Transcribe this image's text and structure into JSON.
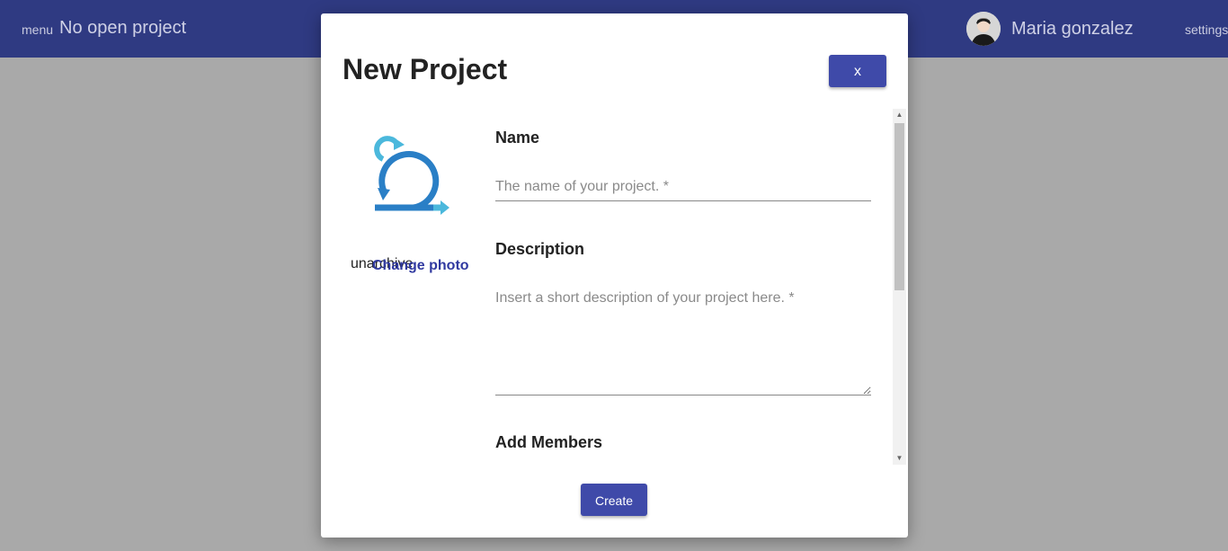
{
  "topbar": {
    "menu_label": "menu",
    "project_title": "No open project",
    "user_name": "Maria gonzalez",
    "settings_label": "settings"
  },
  "modal": {
    "title": "New Project",
    "close_label": "x",
    "unarchive_label": "unarchive",
    "change_photo_label": "Change photo",
    "fields": {
      "name": {
        "label": "Name",
        "placeholder": "The name of your project. *",
        "value": ""
      },
      "description": {
        "label": "Description",
        "placeholder": "Insert a short description of your project here. *",
        "value": ""
      },
      "members": {
        "label": "Add Members"
      }
    },
    "create_label": "Create",
    "scroll_position": 0
  },
  "colors": {
    "topbar": "#2f3a82",
    "primary_button": "#3f4aa9",
    "backdrop": "#a9a9a9",
    "logo_dark": "#2a7fc6",
    "logo_light": "#4bb8dc"
  },
  "icons": {
    "logo": "scrum-cycle-icon",
    "avatar": "user-avatar"
  }
}
